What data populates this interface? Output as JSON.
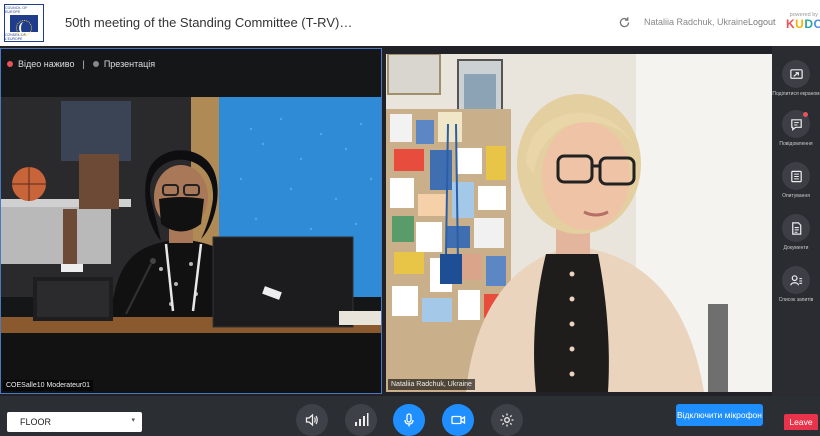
{
  "header": {
    "logo_top_text": "COUNCIL OF EUROPE",
    "logo_bottom_text": "CONSEIL DE L'EUROPE",
    "meeting_title": "50th meeting of the Standing Committee (T-RV)…",
    "user": "Nataliia Radchuk, Ukraine",
    "logout": "Logout",
    "powered_by": "powered by",
    "brand_letters": [
      "K",
      "U",
      "D",
      "O"
    ]
  },
  "modes": {
    "live": "Відео наживо",
    "separator": "|",
    "presentation": "Презентація"
  },
  "tiles": [
    {
      "name": "COESalle10 Moderateur01"
    },
    {
      "name": "Nataliia Radchuk, Ukraine"
    }
  ],
  "sidebar": [
    {
      "label": "Поділитися екраном",
      "icon": "screen-share-icon"
    },
    {
      "label": "Повідомлення",
      "icon": "chat-icon"
    },
    {
      "label": "Опитування",
      "icon": "poll-icon"
    },
    {
      "label": "Документи",
      "icon": "documents-icon"
    },
    {
      "label": "Список запитів",
      "icon": "request-list-icon"
    }
  ],
  "bottom": {
    "floor_select": "FLOOR",
    "mute_microphone": "Відключити мікрофон",
    "leave": "Leave"
  },
  "colors": {
    "accent": "#1f8fff",
    "live_dot": "#e8525b",
    "leave": "#e8334a"
  }
}
